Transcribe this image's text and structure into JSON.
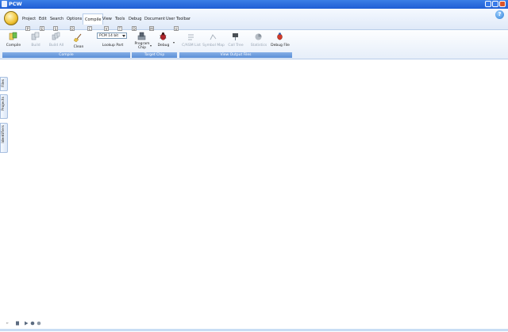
{
  "window": {
    "title": "PCW"
  },
  "menu": {
    "items": [
      {
        "label": "Project",
        "key": "P"
      },
      {
        "label": "Edit",
        "key": "E"
      },
      {
        "label": "Search",
        "key": "S"
      },
      {
        "label": "Options",
        "key": "O"
      },
      {
        "label": "Compile",
        "key": "C",
        "active": true
      },
      {
        "label": "View",
        "key": "V"
      },
      {
        "label": "Tools",
        "key": "T"
      },
      {
        "label": "Debug",
        "key": "D"
      },
      {
        "label": "Document",
        "key": "M"
      },
      {
        "label": "User Toolbar",
        "key": "U"
      }
    ]
  },
  "ribbon": {
    "groups": {
      "compile": "Compile",
      "target_chip": "Target Chip",
      "view_output": "View Output Files"
    },
    "buttons": {
      "compile": "Compile",
      "build": "Build",
      "build_all": "Build All",
      "clean": "Clean",
      "compiler_select": "PCM 14 bit",
      "lookup_part": "Lookup Part",
      "program_chip": "Program Chip",
      "debug": "Debug",
      "c_asm_list": "C/ASM List",
      "symbol_map": "Symbol Map",
      "call_tree": "Call Tree",
      "statistics": "Statistics",
      "debug_file": "Debug File"
    }
  },
  "sidetabs": {
    "files": "Files",
    "projects": "Projects",
    "identifiers": "Identifiers"
  },
  "help": "?",
  "colors": {
    "titlebar": "#1f5ed4",
    "ribbon_group": "#5b8fd7"
  }
}
